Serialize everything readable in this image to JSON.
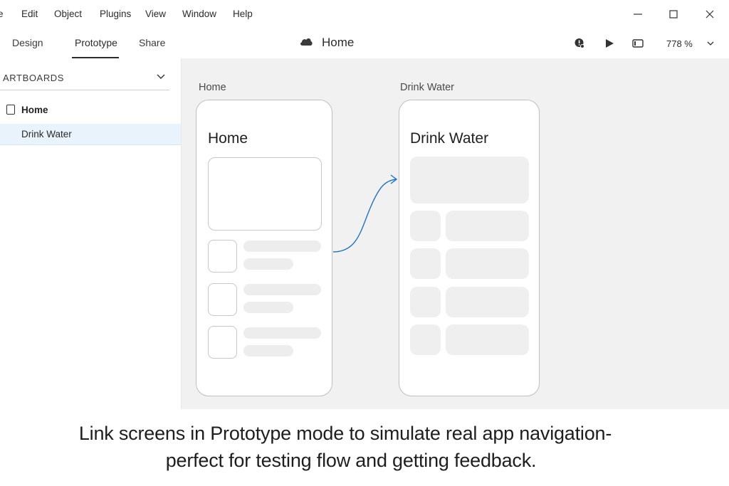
{
  "menu": {
    "items": [
      "e",
      "Edit",
      "Object",
      "Plugins",
      "View",
      "Window",
      "Help"
    ]
  },
  "window_controls": {
    "minimize": "minimize-icon",
    "maximize": "maximize-icon",
    "close": "close-icon"
  },
  "tabs": [
    {
      "label": "Design",
      "active": false
    },
    {
      "label": "Prototype",
      "active": true
    },
    {
      "label": "Share",
      "active": false
    }
  ],
  "document": {
    "title": "Home",
    "icon": "cloud-icon"
  },
  "toolbar": {
    "icons": [
      "user-alert-icon",
      "play-icon",
      "device-preview-icon",
      "chevron-down-icon"
    ],
    "zoom": "778 %"
  },
  "sidebar": {
    "heading": "ARTBOARDS",
    "items": [
      {
        "label": "Home",
        "selected": false,
        "icon": "artboard-icon"
      },
      {
        "label": "Drink Water",
        "selected": true
      }
    ]
  },
  "canvas": {
    "artboards": [
      {
        "label": "Home",
        "title": "Home"
      },
      {
        "label": "Drink Water",
        "title": "Drink Water"
      }
    ],
    "link_color": "#1f73c4"
  },
  "caption": {
    "line1": "Link screens in Prototype mode to simulate real app navigation-",
    "line2": "perfect for testing flow and getting feedback."
  }
}
